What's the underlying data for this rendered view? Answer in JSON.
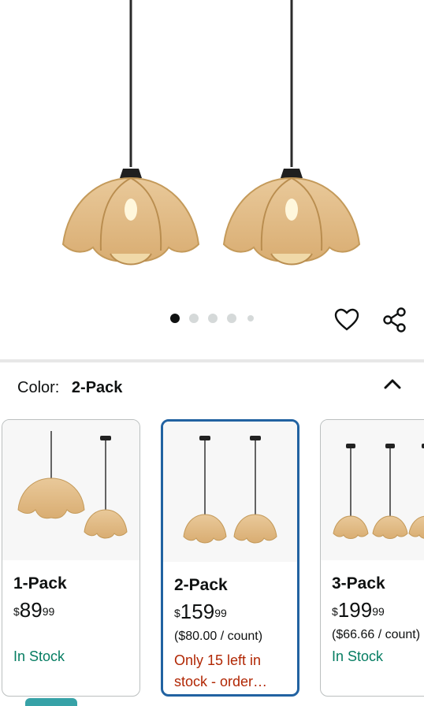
{
  "hero": {
    "image_alt": "Rattan flower pendant lights",
    "dots_total": 5,
    "dots_active": 1
  },
  "actions": {
    "favorite_icon": "heart-icon",
    "share_icon": "share-icon"
  },
  "color_selector": {
    "label": "Color:",
    "value": "2-Pack",
    "toggle_icon": "chevron-up-icon"
  },
  "options": [
    {
      "title": "1-Pack",
      "currency": "$",
      "price_whole": "89",
      "price_fraction": "99",
      "per_unit": "",
      "stock": "In Stock",
      "stock_status": "in"
    },
    {
      "title": "2-Pack",
      "currency": "$",
      "price_whole": "159",
      "price_fraction": "99",
      "per_unit": "($80.00 / count)",
      "stock": "Only 15 left in stock - order…",
      "stock_status": "low"
    },
    {
      "title": "3-Pack",
      "currency": "$",
      "price_whole": "199",
      "price_fraction": "99",
      "per_unit": "($66.66 / count)",
      "stock": "In Stock",
      "stock_status": "in"
    }
  ],
  "colors": {
    "selected_border": "#2162a1",
    "in_stock": "#067d62",
    "low_stock": "#b12704"
  }
}
